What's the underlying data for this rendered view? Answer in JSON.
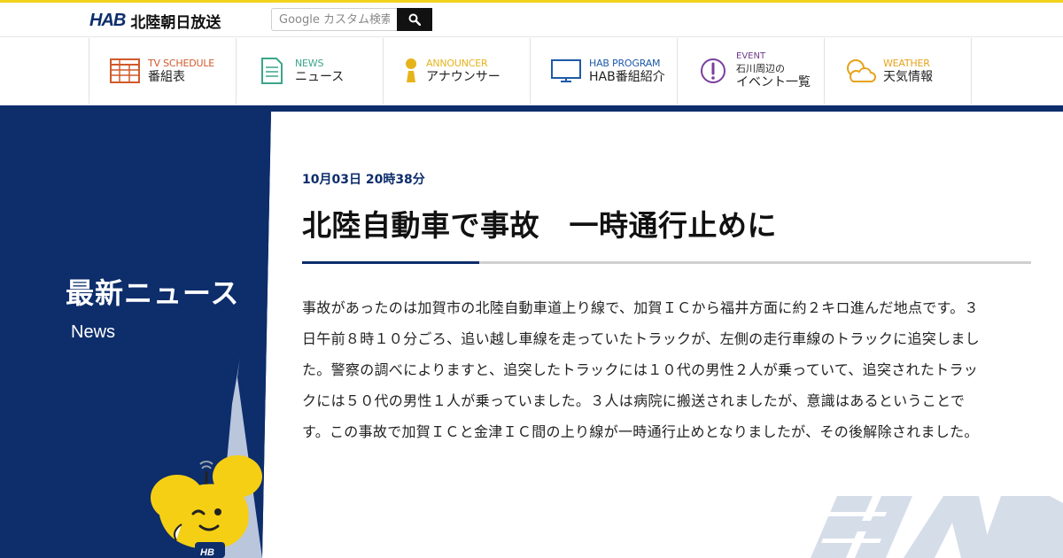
{
  "header": {
    "logo_mark": "HAB",
    "logo_name": "北陸朝日放送",
    "search_placeholder": "Google カスタム検索"
  },
  "nav": [
    {
      "en": "TV SCHEDULE",
      "ja": "番組表",
      "icon": "tv-schedule-icon",
      "color": "#d05a2a"
    },
    {
      "en": "NEWS",
      "ja": "ニュース",
      "icon": "news-icon",
      "color": "#3aa58a"
    },
    {
      "en": "ANNOUNCER",
      "ja": "アナウンサー",
      "icon": "announcer-icon",
      "color": "#e5b41b"
    },
    {
      "en": "HAB PROGRAM",
      "ja": "HAB番組紹介",
      "icon": "monitor-icon",
      "color": "#1e5aa8"
    },
    {
      "en": "EVENT",
      "ja_line1": "石川周辺の",
      "ja_line2": "イベント一覧",
      "icon": "event-icon",
      "color": "#7a3f9d"
    },
    {
      "en": "WEATHER",
      "ja": "天気情報",
      "icon": "weather-icon",
      "color": "#e5a31b"
    }
  ],
  "side": {
    "title": "最新ニュース",
    "subtitle": "News"
  },
  "article": {
    "date": "10月03日 20時38分",
    "headline": "北陸自動車で事故　一時通行止めに",
    "body": "事故があったのは加賀市の北陸自動車道上り線で、加賀ＩＣから福井方面に約２キロ進んだ地点です。３日午前８時１０分ごろ、追い越し車線を走っていたトラックが、左側の走行車線のトラックに追突しました。警察の調べによりますと、追突したトラックには１０代の男性２人が乗っていて、追突されたトラックには５０代の男性１人が乗っていました。３人は病院に搬送されましたが、意識はあるということです。この事故で加賀ＩＣと金津ＩＣ間の上り線が一時通行止めとなりましたが、その後解除されました。"
  },
  "colors": {
    "brand_navy": "#0d2d6b",
    "accent_yellow": "#f2d31b"
  }
}
